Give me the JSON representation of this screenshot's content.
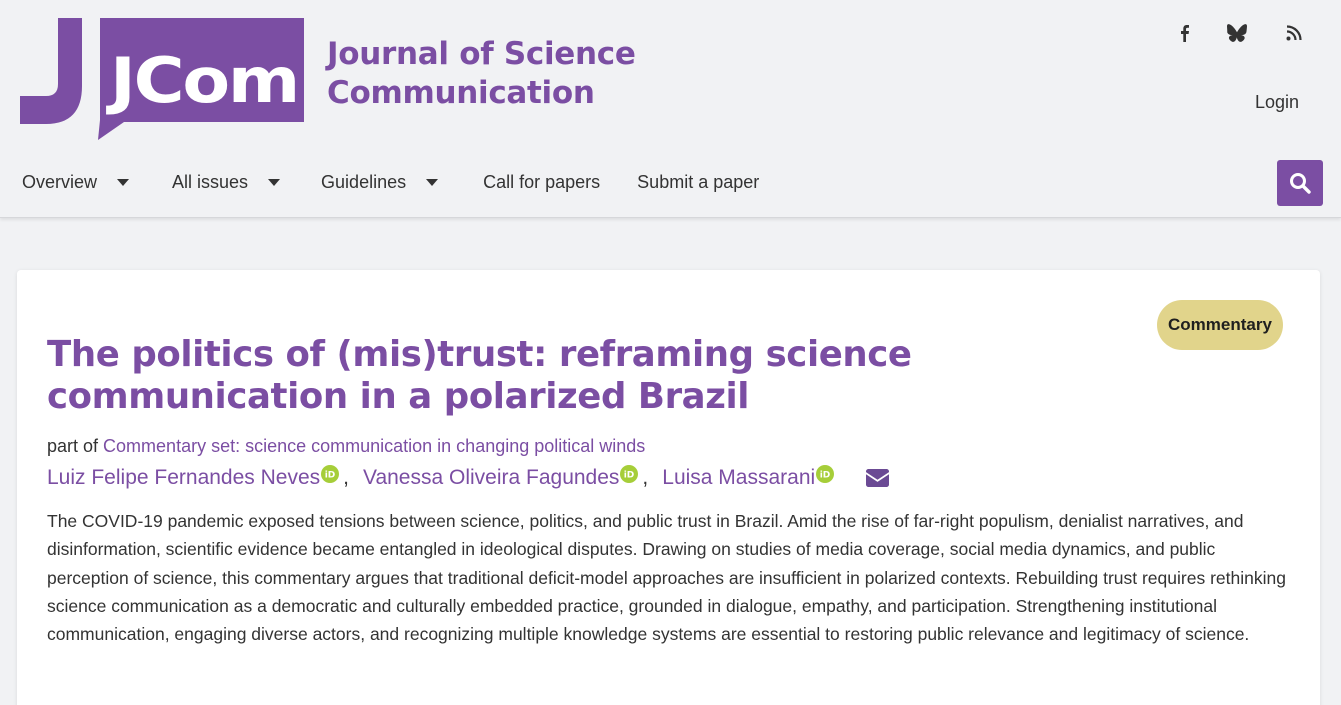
{
  "header": {
    "logo_text": "JCom",
    "site_title_line1": "Journal of Science",
    "site_title_line2": "Communication",
    "login_label": "Login",
    "social_icons": [
      "facebook-icon",
      "bluesky-icon",
      "rss-icon"
    ]
  },
  "nav": {
    "items": [
      {
        "label": "Overview",
        "has_dropdown": true
      },
      {
        "label": "All issues",
        "has_dropdown": true
      },
      {
        "label": "Guidelines",
        "has_dropdown": true
      },
      {
        "label": "Call for papers",
        "has_dropdown": false
      },
      {
        "label": "Submit a paper",
        "has_dropdown": false
      }
    ],
    "search_icon": "search-icon"
  },
  "article": {
    "type_badge": "Commentary",
    "title": "The politics of (mis)trust: reframing science communication in a polarized Brazil",
    "part_of_prefix": "part of",
    "part_of_link": "Commentary set: science communication in changing political winds",
    "authors": [
      {
        "name": "Luiz Felipe Fernandes Neves",
        "orcid": true
      },
      {
        "name": "Vanessa Oliveira Fagundes",
        "orcid": true
      },
      {
        "name": "Luisa Massarani",
        "orcid": true
      }
    ],
    "author_separator": ",",
    "contact_icon": "envelope-icon",
    "abstract": "The COVID-19 pandemic exposed tensions between science, politics, and public trust in Brazil. Amid the rise of far-right populism, denialist narratives, and disinformation, scientific evidence became entangled in ideological disputes. Drawing on studies of media coverage, social media dynamics, and public perception of science, this commentary argues that traditional deficit-model approaches are insufficient in polarized contexts. Rebuilding trust requires rethinking science communication as a democratic and culturally embedded practice, grounded in dialogue, empathy, and participation. Strengthening institutional communication, engaging diverse actors, and recognizing multiple knowledge systems are essential to restoring public relevance and legitimacy of science."
  },
  "colors": {
    "brand_purple": "#7b4ea3",
    "badge_yellow": "#e1d48b",
    "orcid_green": "#a6ce39",
    "page_bg": "#f1f2f4"
  }
}
